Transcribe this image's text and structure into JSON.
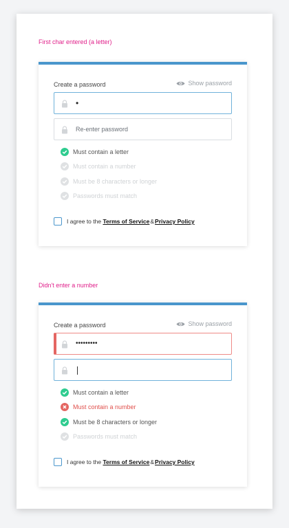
{
  "sections": [
    {
      "title": "First char entered (a letter)",
      "create_label": "Create a password",
      "show_password": "Show password",
      "password_value": "•",
      "reenter_placeholder": "Re-enter password",
      "checks": [
        {
          "label": "Must contain a letter",
          "state": "ok"
        },
        {
          "label": "Must contain a number",
          "state": "pending"
        },
        {
          "label": "Must be 8 characters or longer",
          "state": "pending"
        },
        {
          "label": "Passwords must match",
          "state": "pending"
        }
      ],
      "agree_prefix": "I agree to the",
      "terms": "Terms of Service",
      "amp": "&",
      "privacy": "Privacy Policy"
    },
    {
      "title": "Didn't enter a number",
      "create_label": "Create a password",
      "show_password": "Show password",
      "password_value": "•••••••••",
      "reenter_value": "",
      "checks": [
        {
          "label": "Must contain a letter",
          "state": "ok"
        },
        {
          "label": "Must contain a number",
          "state": "fail"
        },
        {
          "label": "Must be 8 characters or longer",
          "state": "ok"
        },
        {
          "label": "Passwords must match",
          "state": "pending"
        }
      ],
      "agree_prefix": "I agree to the",
      "terms": "Terms of Service",
      "amp": "&",
      "privacy": "Privacy Policy"
    }
  ],
  "colors": {
    "accent": "#4a96cc",
    "section_title": "#e0208a",
    "success": "#2ecc8f",
    "error": "#e46662",
    "pending": "#dfe1e3"
  }
}
